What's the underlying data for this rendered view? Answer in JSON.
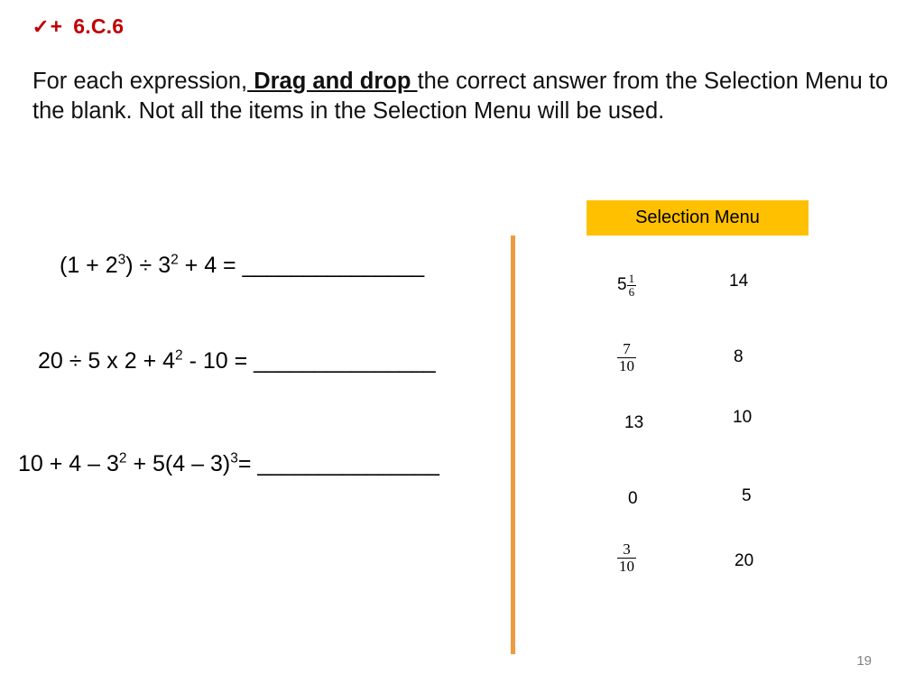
{
  "header": {
    "check_glyph": "✓",
    "plus_glyph": "+",
    "standard_code": "6.C.6",
    "accent_color": "#C00000"
  },
  "instructions": {
    "part1": "For each expression,",
    "emphasis": " Drag and drop ",
    "part2": "the correct answer from the Selection Menu to the blank.   Not all the items in the Selection Menu will be used."
  },
  "divider": {
    "color": "#ED9B40"
  },
  "expressions": [
    {
      "id": "expr-0",
      "open_paren": "(1 + 2",
      "exp1": "3",
      "mid": ") ÷ 3",
      "exp2": "2",
      "tail": " + 4 = ",
      "blank": "_______________"
    },
    {
      "id": "expr-1",
      "open_paren": "20 ÷ 5 x 2 + 4",
      "exp1": "2",
      "mid": " - 10 = ",
      "exp2": "",
      "tail": "",
      "blank": "_______________"
    },
    {
      "id": "expr-2",
      "open_paren": "10 + 4 – 3",
      "exp1": "2",
      "mid": " + 5(4 – 3)",
      "exp2": "3",
      "tail": "= ",
      "blank": "_______________"
    }
  ],
  "selection_menu": {
    "title": "Selection Menu",
    "background_color": "#FFC000",
    "items": [
      {
        "kind": "mixed",
        "whole": "5",
        "num": "1",
        "den": "6",
        "text": "5 1/6"
      },
      {
        "kind": "plain",
        "text": "14"
      },
      {
        "kind": "frac",
        "num": "7",
        "den": "10",
        "text": "7/10"
      },
      {
        "kind": "plain",
        "text": "8"
      },
      {
        "kind": "plain",
        "text": "13"
      },
      {
        "kind": "plain",
        "text": "10"
      },
      {
        "kind": "plain",
        "text": "0"
      },
      {
        "kind": "plain",
        "text": "5"
      },
      {
        "kind": "frac",
        "num": "3",
        "den": "10",
        "text": "3/10"
      },
      {
        "kind": "plain",
        "text": "20"
      }
    ]
  },
  "footer": {
    "page_number": "19"
  }
}
